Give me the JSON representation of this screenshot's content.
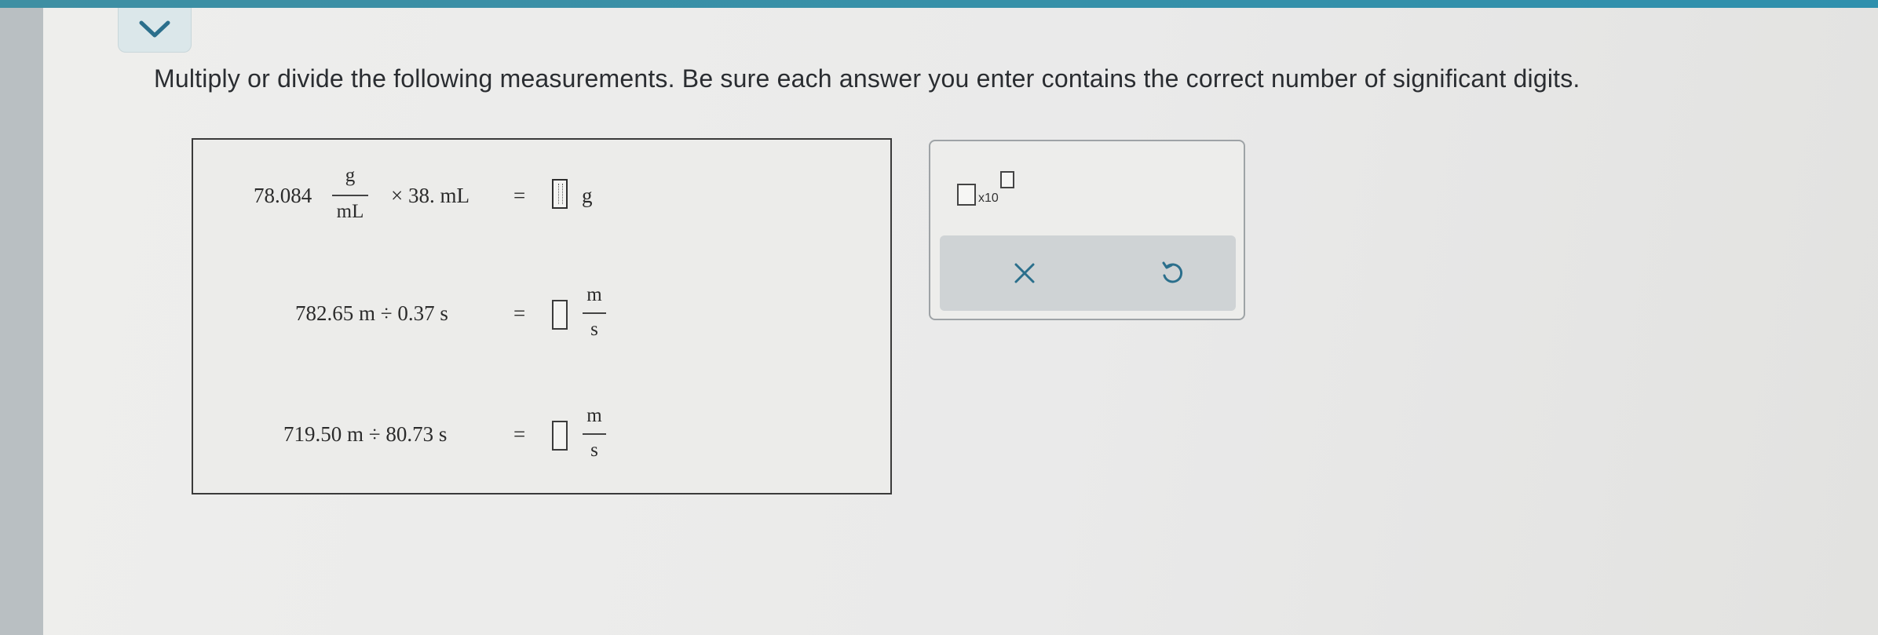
{
  "instructions": "Multiply or divide the following measurements. Be sure each answer you enter contains the correct number of significant digits.",
  "problems": [
    {
      "coef": "78.084",
      "unit_num": "g",
      "unit_den": "mL",
      "op_term": "× 38. mL",
      "equals": "=",
      "answer_value": "",
      "answer_unit": "g"
    },
    {
      "expr": "782.65 m ÷ 0.37 s",
      "equals": "=",
      "answer_value": "",
      "answer_unit_num": "m",
      "answer_unit_den": "s"
    },
    {
      "expr": "719.50 m ÷ 80.73 s",
      "equals": "=",
      "answer_value": "",
      "answer_unit_num": "m",
      "answer_unit_den": "s"
    }
  ],
  "tools": {
    "sci_notation_label": "x10"
  },
  "icons": {
    "collapse": "chevron-down-icon",
    "clear": "close-icon",
    "undo": "undo-icon"
  },
  "colors": {
    "accent_bar": "#3e8fa3",
    "icon_blue": "#2b6f8c"
  }
}
